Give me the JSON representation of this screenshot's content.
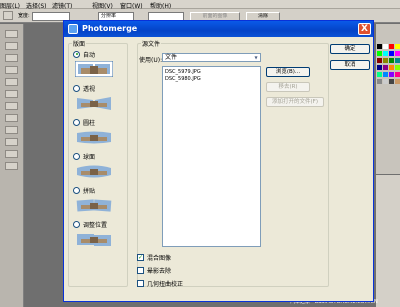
{
  "menubar": {
    "items": [
      "图层(L)",
      "选择(S)",
      "滤镜(T)",
      "视图(V)",
      "窗口(W)",
      "帮助(H)"
    ]
  },
  "options_bar": {
    "width_label": "宽度:",
    "mode_label": "分辨率",
    "clear_label": "清除",
    "front_image_label": "前面的图像"
  },
  "dialog": {
    "title": "Photomerge",
    "close_glyph": "X",
    "ok_label": "确定",
    "cancel_label": "取消",
    "layout": {
      "legend": "版面",
      "options": [
        {
          "label": "自动",
          "checked": true
        },
        {
          "label": "透视",
          "checked": false
        },
        {
          "label": "圆柱",
          "checked": false
        },
        {
          "label": "球面",
          "checked": false
        },
        {
          "label": "拼贴",
          "checked": false
        },
        {
          "label": "调整位置",
          "checked": false
        }
      ]
    },
    "source": {
      "legend": "源文件",
      "use_label": "使用(U):",
      "use_value": "文件",
      "files": [
        "DSC_5979.JPG",
        "DSC_5980.JPG"
      ],
      "browse_label": "浏览(B)...",
      "remove_label": "移去(R)",
      "add_open_label": "添加打开的文件(F)"
    },
    "checkboxes": [
      {
        "label": "混合图像",
        "checked": true
      },
      {
        "label": "晕影去除",
        "checked": false
      },
      {
        "label": "几何扭曲校正",
        "checked": false
      }
    ]
  },
  "colors": {
    "titlebar": "#0a52d6",
    "dialog_bg": "#ece9d8",
    "app_bg": "#6f6f6f"
  },
  "status": {
    "watermark": "汽车之家 · BBS.AUTOHOME.COM.CN"
  }
}
